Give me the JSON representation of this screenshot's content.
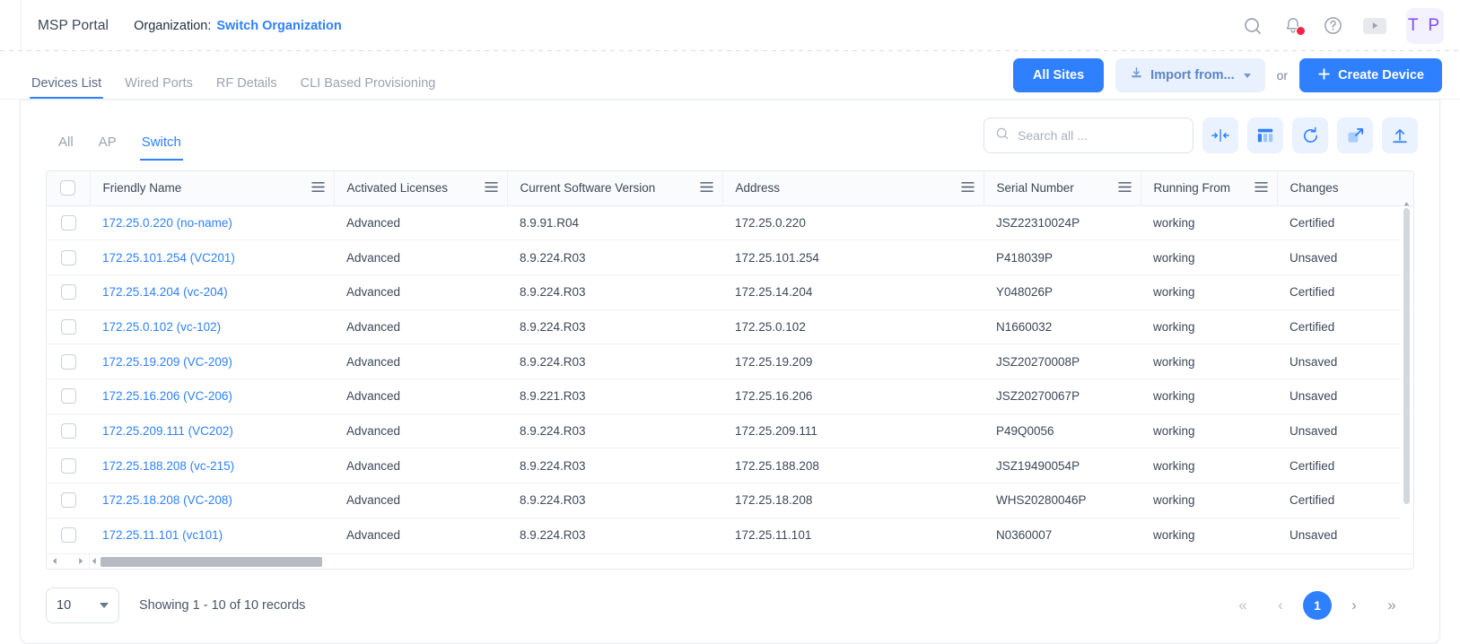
{
  "topbar": {
    "brand": "MSP Portal",
    "org_label": "Organization:",
    "org_link": "Switch Organization",
    "avatar_initials": "T P",
    "icons": {
      "search": "search-icon",
      "notifications": "bell-icon",
      "help": "question-circle-icon",
      "play": "play-icon"
    }
  },
  "tabstrip": {
    "tabs": [
      {
        "label": "Devices List",
        "active": true
      },
      {
        "label": "Wired Ports",
        "active": false
      },
      {
        "label": "RF Details",
        "active": false
      },
      {
        "label": "CLI Based Provisioning",
        "active": false
      }
    ],
    "all_sites_label": "All Sites",
    "import_label": "Import from...",
    "or_label": "or",
    "create_label": "Create Device"
  },
  "card": {
    "subtabs": [
      {
        "label": "All",
        "active": false
      },
      {
        "label": "AP",
        "active": false
      },
      {
        "label": "Switch",
        "active": true
      }
    ],
    "search_placeholder": "Search all ...",
    "search_value": "",
    "toolbar_icons": [
      "collapse-columns-icon",
      "columns-settings-icon",
      "refresh-icon",
      "expand-icon",
      "upload-icon"
    ]
  },
  "table": {
    "columns": [
      "Friendly Name",
      "Activated Licenses",
      "Current Software Version",
      "Address",
      "Serial Number",
      "Running From",
      "Changes"
    ],
    "rows": [
      {
        "name": "172.25.0.220 (no-name)",
        "license": "Advanced",
        "version": "8.9.91.R04",
        "address": "172.25.0.220",
        "serial": "JSZ22310024P",
        "running_from": "working",
        "changes": "Certified"
      },
      {
        "name": "172.25.101.254 (VC201)",
        "license": "Advanced",
        "version": "8.9.224.R03",
        "address": "172.25.101.254",
        "serial": "P418039P",
        "running_from": "working",
        "changes": "Unsaved"
      },
      {
        "name": "172.25.14.204 (vc-204)",
        "license": "Advanced",
        "version": "8.9.224.R03",
        "address": "172.25.14.204",
        "serial": "Y048026P",
        "running_from": "working",
        "changes": "Certified"
      },
      {
        "name": "172.25.0.102 (vc-102)",
        "license": "Advanced",
        "version": "8.9.224.R03",
        "address": "172.25.0.102",
        "serial": "N1660032",
        "running_from": "working",
        "changes": "Certified"
      },
      {
        "name": "172.25.19.209 (VC-209)",
        "license": "Advanced",
        "version": "8.9.224.R03",
        "address": "172.25.19.209",
        "serial": "JSZ20270008P",
        "running_from": "working",
        "changes": "Unsaved"
      },
      {
        "name": "172.25.16.206 (VC-206)",
        "license": "Advanced",
        "version": "8.9.221.R03",
        "address": "172.25.16.206",
        "serial": "JSZ20270067P",
        "running_from": "working",
        "changes": "Unsaved"
      },
      {
        "name": "172.25.209.111 (VC202)",
        "license": "Advanced",
        "version": "8.9.224.R03",
        "address": "172.25.209.111",
        "serial": "P49Q0056",
        "running_from": "working",
        "changes": "Unsaved"
      },
      {
        "name": "172.25.188.208 (vc-215)",
        "license": "Advanced",
        "version": "8.9.224.R03",
        "address": "172.25.188.208",
        "serial": "JSZ19490054P",
        "running_from": "working",
        "changes": "Certified"
      },
      {
        "name": "172.25.18.208 (VC-208)",
        "license": "Advanced",
        "version": "8.9.224.R03",
        "address": "172.25.18.208",
        "serial": "WHS20280046P",
        "running_from": "working",
        "changes": "Certified"
      },
      {
        "name": "172.25.11.101 (vc101)",
        "license": "Advanced",
        "version": "8.9.224.R03",
        "address": "172.25.11.101",
        "serial": "N0360007",
        "running_from": "working",
        "changes": "Unsaved"
      }
    ]
  },
  "footer": {
    "page_size": "10",
    "showing": "Showing 1 - 10 of 10 records",
    "pager": {
      "first": "«",
      "prev": "‹",
      "current_page": "1",
      "next": "›",
      "last": "»"
    }
  },
  "colors": {
    "accent": "#2f80ff",
    "link": "#2f80ff",
    "badge": "#f5234a",
    "avatar_text": "#7b4df0",
    "soft_blue": "#e9f1fe"
  }
}
